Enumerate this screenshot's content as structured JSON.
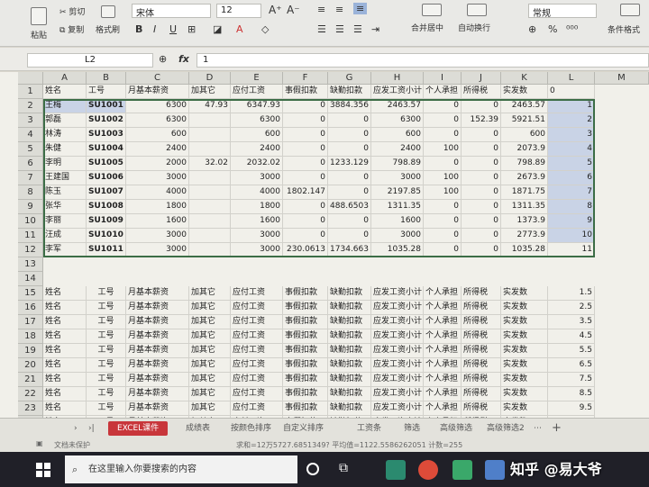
{
  "ribbon": {
    "font_name": "宋体",
    "font_size": "12",
    "number_format": "常规",
    "paste_label": "粘贴",
    "cut_label": "剪切",
    "copy_label": "复制",
    "format_painter_label": "格式刷",
    "merge_center_label": "合并居中",
    "wrap_text_label": "自动换行",
    "percent_symbol": "%",
    "conditional_format_label": "条件格式"
  },
  "formula_bar": {
    "cell_ref": "L2",
    "fx_label": "fx",
    "value": "1"
  },
  "columns": [
    "A",
    "B",
    "C",
    "D",
    "E",
    "F",
    "G",
    "H",
    "I",
    "J",
    "K",
    "L",
    "M"
  ],
  "rows_top": [
    {
      "num": "1",
      "cells": [
        "姓名",
        "工号",
        "月基本薪资",
        "加其它",
        "应付工资",
        "事假扣款",
        "缺勤扣款",
        "应发工资小计",
        "个人承担",
        "所得税",
        "实发数",
        "0"
      ]
    },
    {
      "num": "2",
      "cells": [
        "王梅",
        "SU1001",
        "6300",
        "47.93",
        "6347.93",
        "0",
        "3884.356",
        "2463.57",
        "0",
        "0",
        "2463.57",
        "1"
      ]
    },
    {
      "num": "3",
      "cells": [
        "郭磊",
        "SU1002",
        "6300",
        "",
        "6300",
        "0",
        "0",
        "6300",
        "0",
        "152.39",
        "5921.51",
        "2"
      ]
    },
    {
      "num": "4",
      "cells": [
        "林涛",
        "SU1003",
        "600",
        "",
        "600",
        "0",
        "0",
        "600",
        "0",
        "0",
        "600",
        "3"
      ]
    },
    {
      "num": "5",
      "cells": [
        "朱健",
        "SU1004",
        "2400",
        "",
        "2400",
        "0",
        "0",
        "2400",
        "100",
        "0",
        "2073.9",
        "4"
      ]
    },
    {
      "num": "6",
      "cells": [
        "李明",
        "SU1005",
        "2000",
        "32.02",
        "2032.02",
        "0",
        "1233.129",
        "798.89",
        "0",
        "0",
        "798.89",
        "5"
      ]
    },
    {
      "num": "7",
      "cells": [
        "王建国",
        "SU1006",
        "3000",
        "",
        "3000",
        "0",
        "0",
        "3000",
        "100",
        "0",
        "2673.9",
        "6"
      ]
    },
    {
      "num": "8",
      "cells": [
        "陈玉",
        "SU1007",
        "4000",
        "",
        "4000",
        "1802.147",
        "0",
        "2197.85",
        "100",
        "0",
        "1871.75",
        "7"
      ]
    },
    {
      "num": "9",
      "cells": [
        "张华",
        "SU1008",
        "1800",
        "",
        "1800",
        "0",
        "488.6503",
        "1311.35",
        "0",
        "0",
        "1311.35",
        "8"
      ]
    },
    {
      "num": "10",
      "cells": [
        "李丽",
        "SU1009",
        "1600",
        "",
        "1600",
        "0",
        "0",
        "1600",
        "0",
        "0",
        "1373.9",
        "9"
      ]
    },
    {
      "num": "11",
      "cells": [
        "汪成",
        "SU1010",
        "3000",
        "",
        "3000",
        "0",
        "0",
        "3000",
        "0",
        "0",
        "2773.9",
        "10"
      ]
    },
    {
      "num": "12",
      "cells": [
        "李军",
        "SU1011",
        "3000",
        "",
        "3000",
        "230.0613",
        "1734.663",
        "1035.28",
        "0",
        "0",
        "1035.28",
        "11"
      ]
    }
  ],
  "rows_gap": [
    "13",
    "14"
  ],
  "repeat_header": [
    "姓名",
    "工号",
    "月基本薪资",
    "加其它",
    "应付工资",
    "事假扣款",
    "缺勤扣款",
    "应发工资小计",
    "个人承担",
    "所得税",
    "实发数"
  ],
  "repeat_rows": [
    {
      "num": "15",
      "l": "1.5"
    },
    {
      "num": "16",
      "l": "2.5"
    },
    {
      "num": "17",
      "l": "3.5"
    },
    {
      "num": "18",
      "l": "4.5"
    },
    {
      "num": "19",
      "l": "5.5"
    },
    {
      "num": "20",
      "l": "6.5"
    },
    {
      "num": "21",
      "l": "7.5"
    },
    {
      "num": "22",
      "l": "8.5"
    },
    {
      "num": "23",
      "l": "9.5"
    },
    {
      "num": "24",
      "l": "10.5"
    },
    {
      "num": "25",
      "l": "11.5"
    }
  ],
  "sheet_tabs": [
    "EXCEL课件",
    "成绩表",
    "按颜色排序",
    "自定义排序",
    "工资条",
    "筛选",
    "高级筛选",
    "高级筛选2"
  ],
  "status": {
    "protect": "文档未保护",
    "summary": "求和=12万5727.6851349?  平均值=1122.5586262051  计数=255"
  },
  "taskbar": {
    "search_placeholder": "在这里输入你要搜索的内容"
  },
  "watermark": "知乎 @易大爷"
}
